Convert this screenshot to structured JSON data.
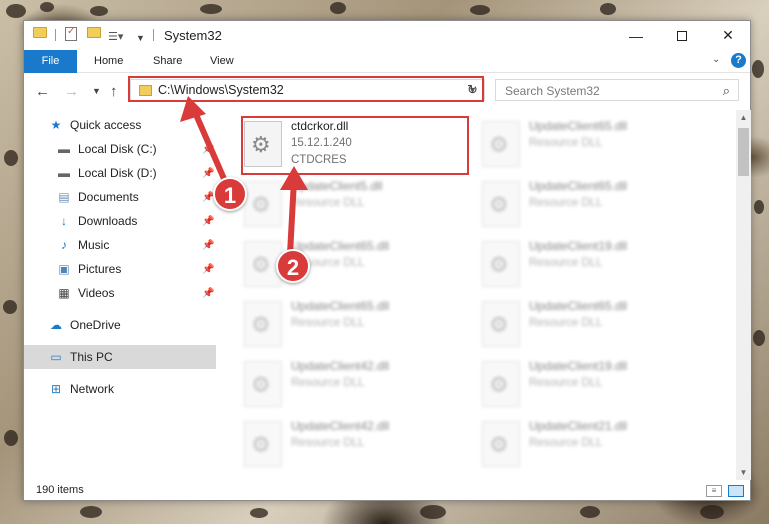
{
  "window": {
    "title": "System32",
    "controls": {
      "minimize": "—",
      "maximize": "",
      "close": "✕"
    }
  },
  "ribbon": {
    "tabs": [
      "File",
      "Home",
      "Share",
      "View"
    ],
    "help": "?"
  },
  "nav": {
    "address": "C:\\Windows\\System32",
    "search_placeholder": "Search System32"
  },
  "sidebar": {
    "items": [
      {
        "label": "Quick access",
        "icon": "star-icon",
        "pinned": false
      },
      {
        "label": "Local Disk (C:)",
        "icon": "drive-icon",
        "pinned": true
      },
      {
        "label": "Local Disk (D:)",
        "icon": "drive-icon",
        "pinned": true
      },
      {
        "label": "Documents",
        "icon": "documents-icon",
        "pinned": true
      },
      {
        "label": "Downloads",
        "icon": "download-icon",
        "pinned": true
      },
      {
        "label": "Music",
        "icon": "music-icon",
        "pinned": true
      },
      {
        "label": "Pictures",
        "icon": "pictures-icon",
        "pinned": true
      },
      {
        "label": "Videos",
        "icon": "videos-icon",
        "pinned": true
      },
      {
        "label": "OneDrive",
        "icon": "cloud-icon",
        "pinned": false
      },
      {
        "label": "This PC",
        "icon": "computer-icon",
        "pinned": false,
        "selected": true
      },
      {
        "label": "Network",
        "icon": "network-icon",
        "pinned": false
      }
    ]
  },
  "files": {
    "highlighted": {
      "name": "ctdcrkor.dll",
      "version": "15.12.1.240",
      "company": "CTDCRES"
    },
    "left": [
      {
        "name": "UpdateClient5.dll",
        "desc": "Resource DLL"
      },
      {
        "name": "UpdateClient65.dll",
        "desc": "Resource DLL"
      },
      {
        "name": "UpdateClient65.dll",
        "desc": "Resource DLL"
      },
      {
        "name": "UpdateClient42.dll",
        "desc": "Resource DLL"
      },
      {
        "name": "UpdateClient42.dll",
        "desc": "Resource DLL"
      }
    ],
    "right": [
      {
        "name": "UpdateClient65.dll",
        "desc": "Resource DLL"
      },
      {
        "name": "UpdateClient65.dll",
        "desc": "Resource DLL"
      },
      {
        "name": "UpdateClient19.dll",
        "desc": "Resource DLL"
      },
      {
        "name": "UpdateClient65.dll",
        "desc": "Resource DLL"
      },
      {
        "name": "UpdateClient19.dll",
        "desc": "Resource DLL"
      },
      {
        "name": "UpdateClient21.dll",
        "desc": "Resource DLL"
      }
    ]
  },
  "status": {
    "item_count": "190 items"
  },
  "callouts": {
    "step1": "1",
    "step2": "2",
    "color": "#d93a3a"
  }
}
